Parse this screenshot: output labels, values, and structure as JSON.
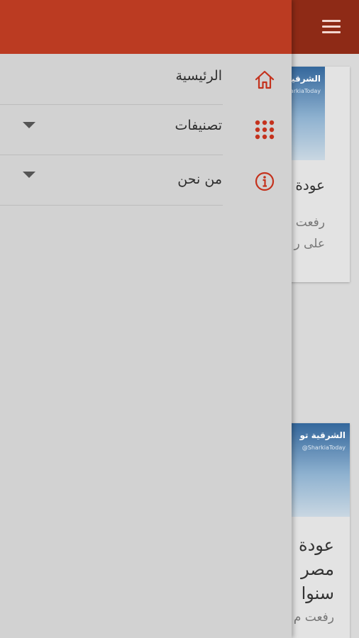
{
  "colors": {
    "drawer_header": "#bb3b22",
    "appbar_dimmed": "#8e2a16",
    "drawer_bg": "#d2d2d2",
    "accent_icon": "#c4321d"
  },
  "drawer": {
    "items": [
      {
        "label": "الرئيسية",
        "icon": "home-icon",
        "expandable": false
      },
      {
        "label": "تصنيفات",
        "icon": "grid-icon",
        "expandable": true
      },
      {
        "label": "من نحن",
        "icon": "info-icon",
        "expandable": true
      }
    ]
  },
  "background": {
    "menu_icon": "hamburger-menu-icon",
    "cards": [
      {
        "thumb_brand": "الشرقية",
        "thumb_sub": "SharkiaToday",
        "title": "عودة",
        "lines": [
          "رفعت",
          "على ر"
        ]
      },
      {
        "thumb_brand": "الشرقية تو",
        "thumb_sub": "@SharkiaToday",
        "title_lines": [
          "عودة",
          "مصر",
          "سنوا"
        ],
        "lines": [
          "رفعت م"
        ]
      }
    ]
  }
}
